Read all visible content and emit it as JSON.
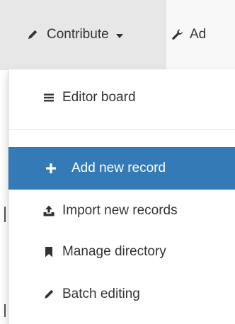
{
  "navbar": {
    "contribute_label": "Contribute",
    "admin_label": "Ad"
  },
  "menu": {
    "items": [
      {
        "label": "Editor board",
        "icon": "list-icon"
      },
      {
        "label": "Add new record",
        "icon": "plus-icon"
      },
      {
        "label": "Import new records",
        "icon": "upload-icon"
      },
      {
        "label": "Manage directory",
        "icon": "bookmark-icon"
      },
      {
        "label": "Batch editing",
        "icon": "pencil-icon"
      }
    ]
  },
  "colors": {
    "active_bg": "#337ab7",
    "navbar_bg": "#f8f8f8",
    "active_nav_bg": "#e7e7e7",
    "text": "#333333"
  }
}
